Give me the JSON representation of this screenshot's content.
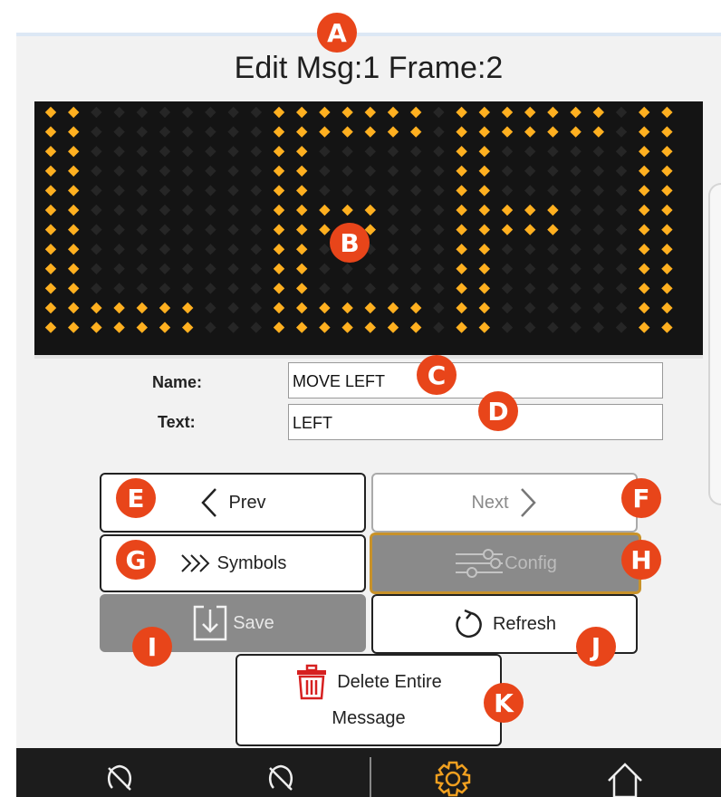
{
  "page": {
    "title": "Edit Msg:1 Frame:2"
  },
  "led_display": {
    "text": "LEFT",
    "rows": 12,
    "cols": 28,
    "on_color": "#ffb020",
    "off_color": "#262626",
    "background": "#141414",
    "lit_pixels": [
      "OO........OOOOOOO.OOOOOOO.OO",
      "OO........OOOOOOO.OOOOOOO.OO",
      "OO........OO......OO......OO",
      "OO........OO......OO......OO",
      "OO........OO......OO......OO",
      "OO........OOOOO...OOOOO...OO",
      "OO........OOOOO...OOOOO...OO",
      "OO........OO......OO......OO",
      "OO........OO......OO......OO",
      "OO........OO......OO......OO",
      "OOOOOOO...OOOOOOO.OO......OO",
      "OOOOOOO...OOOOOOO.OO......OO"
    ]
  },
  "form": {
    "name_label": "Name:",
    "name_value": "MOVE LEFT",
    "text_label": "Text:",
    "text_value": "LEFT"
  },
  "buttons": {
    "prev": "Prev",
    "next": "Next",
    "symbols": "Symbols",
    "config": "Config",
    "save": "Save",
    "refresh": "Refresh",
    "delete_line1": "Delete Entire",
    "delete_line2": "Message"
  },
  "annotations": [
    "A",
    "B",
    "C",
    "D",
    "E",
    "F",
    "G",
    "H",
    "I",
    "J",
    "K"
  ],
  "colors": {
    "badge": "#e8451a",
    "config_border": "#c8922a",
    "delete_icon": "#d62020",
    "nav_active": "#f0a020"
  },
  "navbar": {
    "icons": [
      "lightbulb-off-icon",
      "lightbulb-off-icon",
      "gear-icon",
      "home-icon"
    ]
  }
}
